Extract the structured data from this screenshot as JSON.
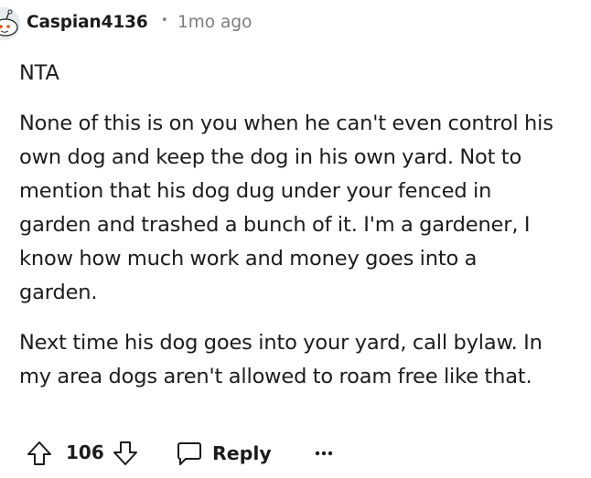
{
  "comment": {
    "author": "Caspian4136",
    "separator": "•",
    "timestamp": "1mo ago",
    "paragraphs": [
      "NTA",
      "None of this is on you when he can't even control his\nown dog and keep the dog in his own yard. Not to\nmention that his dog dug under your fenced in\ngarden and trashed a bunch of it. I'm a gardener, I\nknow how much work and money goes into a\ngarden.",
      "Next time his dog goes into your yard, call bylaw. In\nmy area dogs aren't allowed to roam free like that."
    ],
    "score": "106",
    "reply_label": "Reply",
    "icons": {
      "avatar": "reddit-snoo-avatar",
      "upvote": "arrow-up-icon",
      "downvote": "arrow-down-icon",
      "reply": "speech-bubble-icon",
      "more": "more-horizontal-icon"
    },
    "colors": {
      "text": "#1c1c1c",
      "meta": "#7c7c7c"
    }
  }
}
